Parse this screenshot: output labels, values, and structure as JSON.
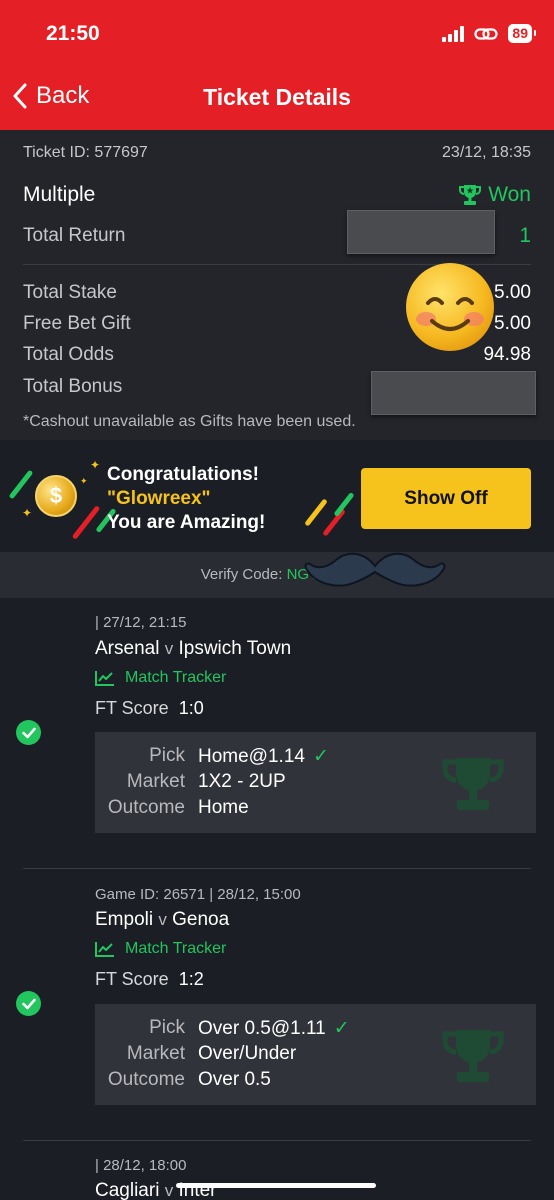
{
  "status_bar": {
    "time": "21:50",
    "battery": "89"
  },
  "header": {
    "back_label": "Back",
    "title": "Ticket Details"
  },
  "ticket": {
    "id_label": "Ticket ID: 577697",
    "datetime": "23/12, 18:35",
    "type": "Multiple",
    "status": "Won",
    "total_return_label": "Total Return",
    "total_return_value": "1",
    "total_stake_label": "Total Stake",
    "total_stake_value": "5.00",
    "free_bet_label": "Free Bet Gift",
    "free_bet_value": "5.00",
    "total_odds_label": "Total Odds",
    "total_odds_value": "94.98",
    "total_bonus_label": "Total Bonus",
    "note": "*Cashout unavailable as Gifts have been used."
  },
  "promo": {
    "line1": "Congratulations!",
    "line2": "\"Glowreex\"",
    "line3": "You are Amazing!",
    "button": "Show Off",
    "coin_symbol": "$"
  },
  "verify": {
    "label": "Verify Code:",
    "code": "NGTE146"
  },
  "legs": [
    {
      "meta": "| 27/12, 21:15",
      "home": "Arsenal",
      "vs": "v",
      "away": "Ipswich Town",
      "tracker": "Match Tracker",
      "ft_label": "FT Score",
      "ft_score": "1:0",
      "pick_label": "Pick",
      "pick_value": "Home@1.14",
      "market_label": "Market",
      "market_value": "1X2 - 2UP",
      "outcome_label": "Outcome",
      "outcome_value": "Home"
    },
    {
      "meta": "Game ID: 26571 | 28/12, 15:00",
      "home": "Empoli",
      "vs": "v",
      "away": "Genoa",
      "tracker": "Match Tracker",
      "ft_label": "FT Score",
      "ft_score": "1:2",
      "pick_label": "Pick",
      "pick_value": "Over 0.5@1.11",
      "market_label": "Market",
      "market_value": "Over/Under",
      "outcome_label": "Outcome",
      "outcome_value": "Over 0.5"
    },
    {
      "meta": "| 28/12, 18:00",
      "home": "Cagliari",
      "vs": "v",
      "away": "Inter"
    }
  ],
  "colors": {
    "header_red": "#e41f26",
    "win_green": "#22c55e",
    "accent_yellow": "#f6c21c",
    "bg_dark": "#1c1e25"
  },
  "icons": [
    "chevron-left-icon",
    "trophy-icon",
    "check-circle-icon",
    "chart-line-icon",
    "coin-icon",
    "smiley-emoji-icon",
    "mustache-emoji-icon"
  ]
}
